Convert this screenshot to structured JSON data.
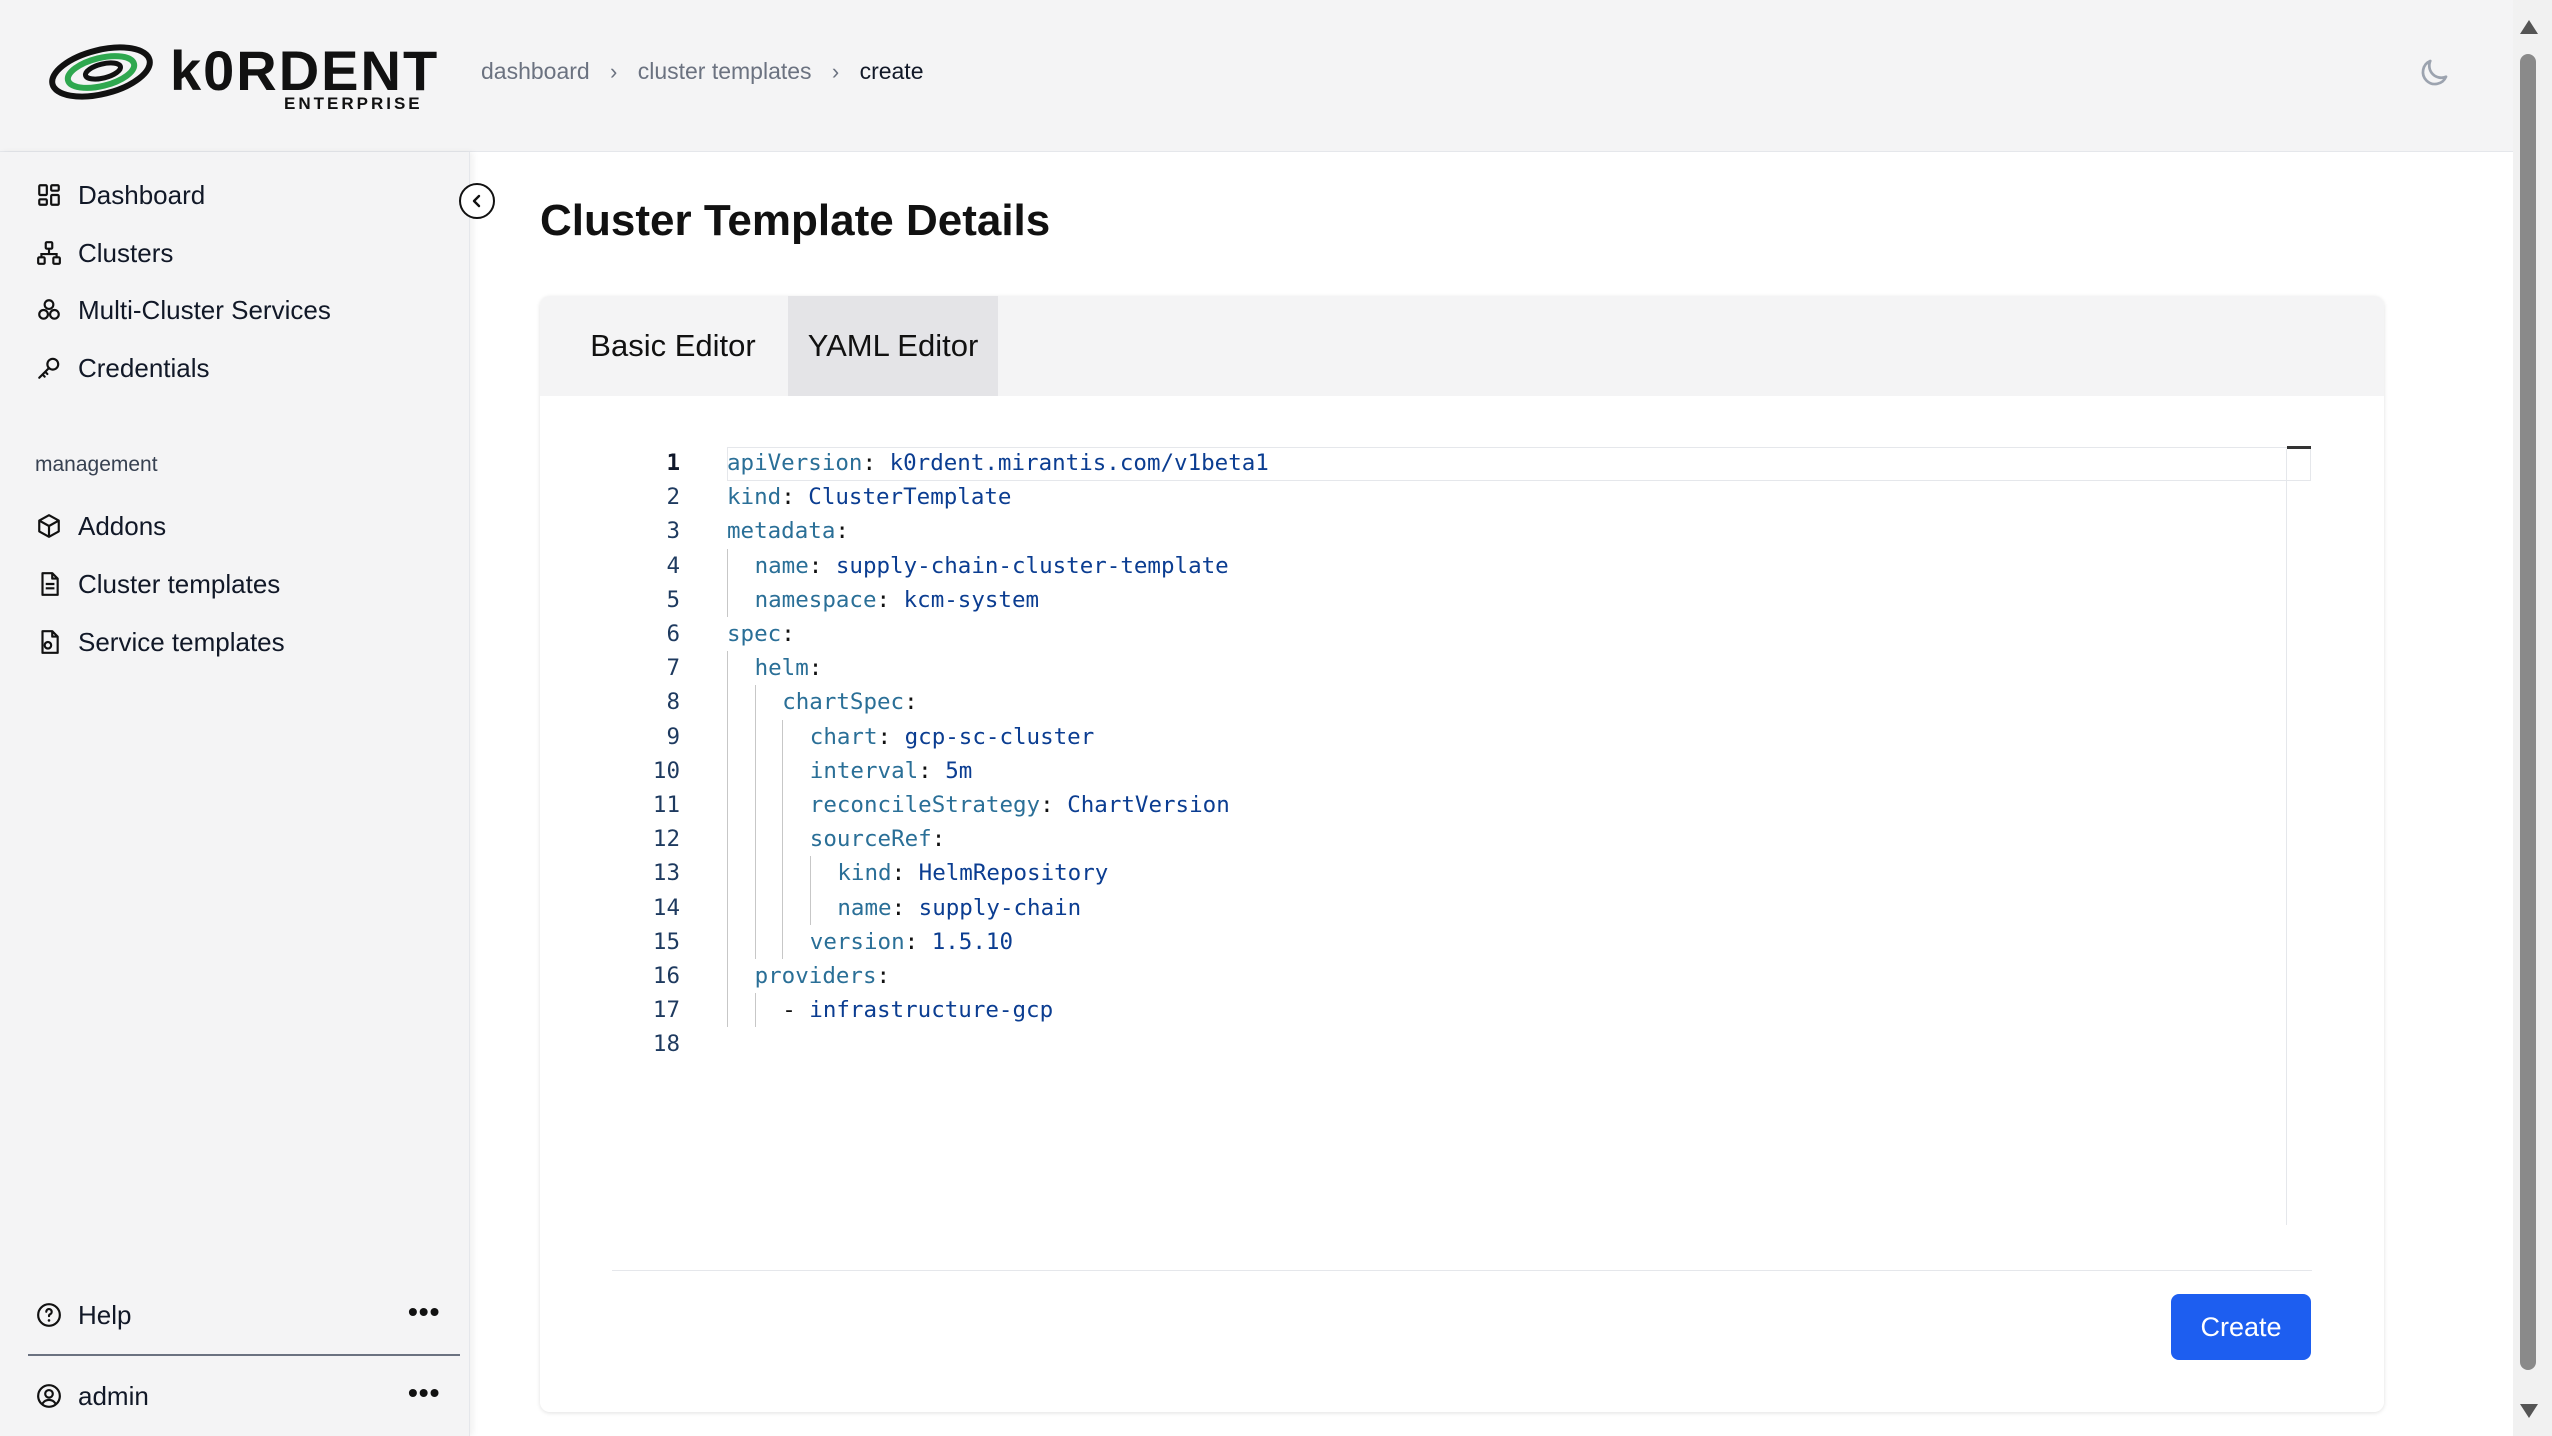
{
  "brand": {
    "name": "k0RDENT",
    "edition": "ENTERPRISE"
  },
  "breadcrumb": [
    "dashboard",
    "cluster templates",
    "create"
  ],
  "sidebar": {
    "items": [
      {
        "label": "Dashboard",
        "icon": "dashboard-icon"
      },
      {
        "label": "Clusters",
        "icon": "clusters-icon"
      },
      {
        "label": "Multi-Cluster Services",
        "icon": "multi-cluster-services-icon"
      },
      {
        "label": "Credentials",
        "icon": "key-icon"
      }
    ],
    "section_label": "management",
    "management_items": [
      {
        "label": "Addons",
        "icon": "box-icon"
      },
      {
        "label": "Cluster templates",
        "icon": "file-text-icon"
      },
      {
        "label": "Service templates",
        "icon": "file-gear-icon"
      }
    ],
    "help_label": "Help",
    "user_label": "admin"
  },
  "page": {
    "title": "Cluster Template Details"
  },
  "tabs": [
    {
      "label": "Basic Editor",
      "active": false
    },
    {
      "label": "YAML Editor",
      "active": true
    }
  ],
  "editor": {
    "current_line": 1,
    "lines": [
      {
        "no": "1",
        "indent": 0,
        "key": "apiVersion",
        "sep": ": ",
        "value": "k0rdent.mirantis.com/v1beta1"
      },
      {
        "no": "2",
        "indent": 0,
        "key": "kind",
        "sep": ": ",
        "value": "ClusterTemplate"
      },
      {
        "no": "3",
        "indent": 0,
        "key": "metadata",
        "sep": ":",
        "value": ""
      },
      {
        "no": "4",
        "indent": 1,
        "key": "name",
        "sep": ": ",
        "value": "supply-chain-cluster-template"
      },
      {
        "no": "5",
        "indent": 1,
        "key": "namespace",
        "sep": ": ",
        "value": "kcm-system"
      },
      {
        "no": "6",
        "indent": 0,
        "key": "spec",
        "sep": ":",
        "value": ""
      },
      {
        "no": "7",
        "indent": 1,
        "key": "helm",
        "sep": ":",
        "value": ""
      },
      {
        "no": "8",
        "indent": 2,
        "key": "chartSpec",
        "sep": ":",
        "value": ""
      },
      {
        "no": "9",
        "indent": 3,
        "key": "chart",
        "sep": ": ",
        "value": "gcp-sc-cluster"
      },
      {
        "no": "10",
        "indent": 3,
        "key": "interval",
        "sep": ": ",
        "value": "5m"
      },
      {
        "no": "11",
        "indent": 3,
        "key": "reconcileStrategy",
        "sep": ": ",
        "value": "ChartVersion"
      },
      {
        "no": "12",
        "indent": 3,
        "key": "sourceRef",
        "sep": ":",
        "value": ""
      },
      {
        "no": "13",
        "indent": 4,
        "key": "kind",
        "sep": ": ",
        "value": "HelmRepository"
      },
      {
        "no": "14",
        "indent": 4,
        "key": "name",
        "sep": ": ",
        "value": "supply-chain"
      },
      {
        "no": "15",
        "indent": 3,
        "key": "version",
        "sep": ": ",
        "value": "1.5.10"
      },
      {
        "no": "16",
        "indent": 1,
        "key": "providers",
        "sep": ":",
        "value": ""
      },
      {
        "no": "17",
        "indent": 2,
        "key": "- ",
        "sep": "",
        "value": "infrastructure-gcp"
      },
      {
        "no": "18",
        "indent": 0,
        "key": "",
        "sep": "",
        "value": ""
      }
    ]
  },
  "actions": {
    "create_label": "Create"
  },
  "colors": {
    "primary": "#1d5ef0",
    "yaml_key": "#2a6f97",
    "yaml_value": "#0b3d91"
  }
}
